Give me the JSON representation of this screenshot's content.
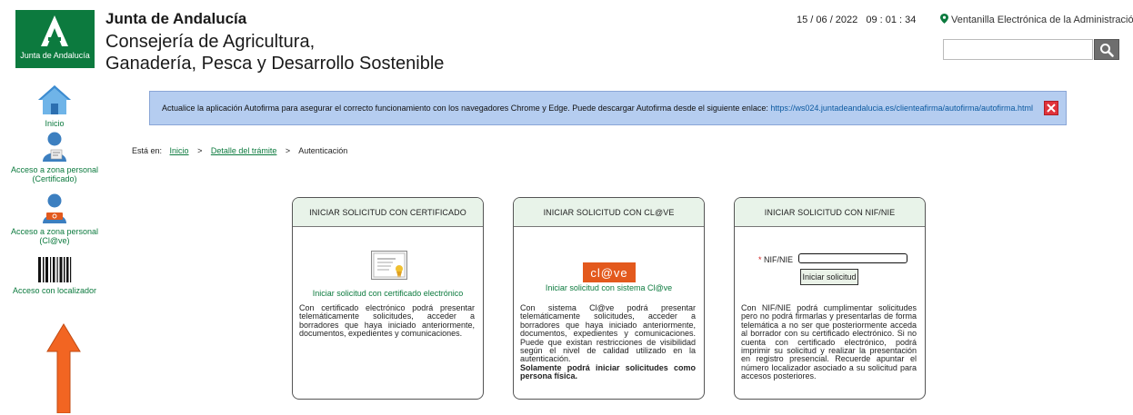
{
  "header": {
    "logo_text": "Junta de Andalucía",
    "org_name": "Junta de Andalucía",
    "department_line1": "Consejería de Agricultura,",
    "department_line2": "Ganadería, Pesca y Desarrollo Sostenible",
    "date": "15 / 06 / 2022",
    "time": "09 : 01 : 34",
    "portal_link": "Ventanilla Electrónica de la Administración",
    "search_value": ""
  },
  "sidebar": {
    "items": [
      {
        "label": "Inicio",
        "icon": "home-icon"
      },
      {
        "label": "Acceso a zona personal (Certificado)",
        "icon": "user-certificate-icon"
      },
      {
        "label": "Acceso a zona personal (Cl@ve)",
        "icon": "user-clave-icon"
      },
      {
        "label": "Acceso con localizador",
        "icon": "barcode-icon"
      }
    ]
  },
  "notice": {
    "text": "Actualice la aplicación Autofirma para asegurar el correcto funcionamiento con los navegadores Chrome y Edge. Puede descargar Autofirma desde el siguiente enlace: ",
    "link": "https://ws024.juntadeandalucia.es/clienteafirma/autofirma/autofirma.html"
  },
  "breadcrumb": {
    "prefix": "Está en:",
    "items": [
      "Inicio",
      "Detalle del trámite",
      "Autenticación"
    ],
    "separator": ">"
  },
  "cards": {
    "certificado": {
      "title": "INICIAR SOLICITUD CON CERTIFICADO",
      "link": "Iniciar solicitud con certificado electrónico",
      "desc": "Con certificado electrónico podrá presentar telemáticamente solicitudes, acceder a borradores que haya iniciado anteriormente, documentos, expedientes y comunicaciones."
    },
    "clave": {
      "title": "INICIAR SOLICITUD CON CL@VE",
      "logo": "cl@ve",
      "link": "Iniciar solicitud con sistema Cl@ve",
      "desc": "Con sistema Cl@ve podrá presentar telemáticamente solicitudes, acceder a borradores que haya iniciado anteriormente, documentos, expedientes y comunicaciones. Puede que existan restricciones de visibilidad según el nivel de calidad utilizado en la autenticación.",
      "desc_bold": "Solamente podrá iniciar solicitudes como persona física."
    },
    "nif": {
      "title": "INICIAR SOLICITUD CON NIF/NIE",
      "field_required_mark": "*",
      "field_label": "NIF/NIE",
      "field_value": "",
      "button": "Iniciar solicitud",
      "desc": "Con NIF/NIE podrá cumplimentar solicitudes pero no podrá firmarlas y presentarlas de forma telemática a no ser que posteriormente acceda al borrador con su certificado electrónico. Si no cuenta con certificado electrónico, podrá imprimir su solicitud y realizar la presentación en registro presencial. Recuerde apuntar el número localizador asociado a su solicitud para accesos posteriores."
    }
  },
  "colors": {
    "brand_green": "#0c7a3e",
    "notice_bg": "#b5cdf0",
    "close_red": "#e0333b",
    "clave_orange": "#e3591d",
    "arrow_orange": "#f26522"
  }
}
